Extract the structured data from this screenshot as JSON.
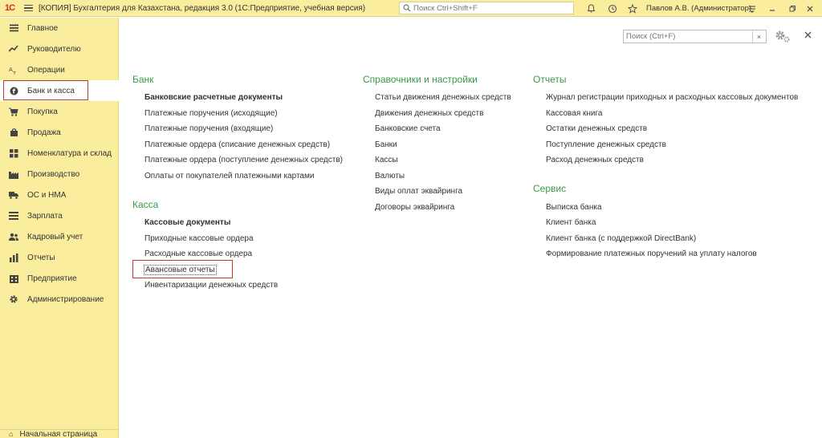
{
  "titlebar": {
    "logo": "1С",
    "app_title": "[КОПИЯ] Бухгалтерия для Казахстана, редакция 3.0  (1С:Предприятие, учебная версия)",
    "search_placeholder": "Поиск Ctrl+Shift+F",
    "user": "Павлов А.В. (Администратор)"
  },
  "sidebar": {
    "items": [
      {
        "label": "Главное",
        "icon": "menu-lines-icon"
      },
      {
        "label": "Руководителю",
        "icon": "trend-icon"
      },
      {
        "label": "Операции",
        "icon": "operations-icon"
      },
      {
        "label": "Банк и касса",
        "icon": "bank-coin-icon"
      },
      {
        "label": "Покупка",
        "icon": "cart-icon"
      },
      {
        "label": "Продажа",
        "icon": "sale-icon"
      },
      {
        "label": "Номенклатура и склад",
        "icon": "grid-icon"
      },
      {
        "label": "Производство",
        "icon": "factory-icon"
      },
      {
        "label": "ОС и НМА",
        "icon": "truck-icon"
      },
      {
        "label": "Зарплата",
        "icon": "salary-icon"
      },
      {
        "label": "Кадровый учет",
        "icon": "people-icon"
      },
      {
        "label": "Отчеты",
        "icon": "chart-icon"
      },
      {
        "label": "Предприятие",
        "icon": "building-icon"
      },
      {
        "label": "Администрирование",
        "icon": "gear-icon"
      }
    ],
    "home_page": "Начальная страница"
  },
  "panel": {
    "search_placeholder": "Поиск (Ctrl+F)"
  },
  "sections": {
    "bank": {
      "title": "Банк",
      "links": [
        "Банковские расчетные документы",
        "Платежные поручения (исходящие)",
        "Платежные поручения (входящие)",
        "Платежные ордера (списание денежных средств)",
        "Платежные ордера (поступление денежных средств)",
        "Оплаты от покупателей платежными картами"
      ]
    },
    "kassa": {
      "title": "Касса",
      "links": [
        "Кассовые документы",
        "Приходные кассовые ордера",
        "Расходные кассовые ордера",
        "Авансовые отчеты",
        "Инвентаризации денежных средств"
      ]
    },
    "refs": {
      "title": "Справочники и настройки",
      "links": [
        "Статьи движения денежных средств",
        "Движения денежных средств",
        "Банковские счета",
        "Банки",
        "Кассы",
        "Валюты",
        "Виды оплат эквайринга",
        "Договоры эквайринга"
      ]
    },
    "reports": {
      "title": "Отчеты",
      "links": [
        "Журнал регистрации приходных и расходных кассовых документов",
        "Кассовая книга",
        "Остатки денежных средств",
        "Поступление денежных средств",
        "Расход денежных средств"
      ]
    },
    "service": {
      "title": "Сервис",
      "links": [
        "Выписка банка",
        "Клиент банка",
        "Клиент банка (с поддержкой DirectBank)",
        "Формирование платежных поручений на уплату налогов"
      ]
    }
  }
}
